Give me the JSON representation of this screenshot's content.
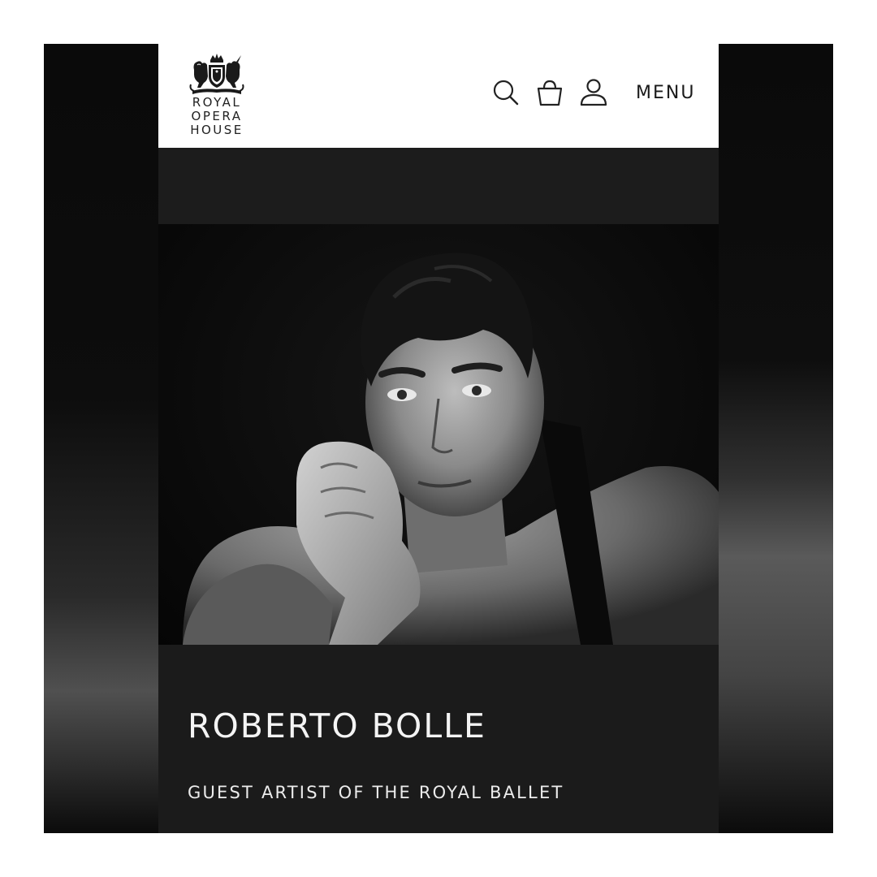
{
  "header": {
    "logo": {
      "lines": [
        "ROYAL",
        "OPERA",
        "HOUSE"
      ],
      "emblem": "royal-crest"
    },
    "icons": {
      "search": "search-icon",
      "basket": "basket-icon",
      "account": "account-icon"
    },
    "menu_label": "MENU"
  },
  "hero": {
    "photo": "black-and-white-portrait"
  },
  "artist": {
    "name": "ROBERTO BOLLE",
    "role": "GUEST ARTIST OF THE ROYAL BALLET"
  },
  "colors": {
    "header_background": "#ffffff",
    "page_background": "#1b1b1b",
    "text_light": "#f4f4f4"
  }
}
